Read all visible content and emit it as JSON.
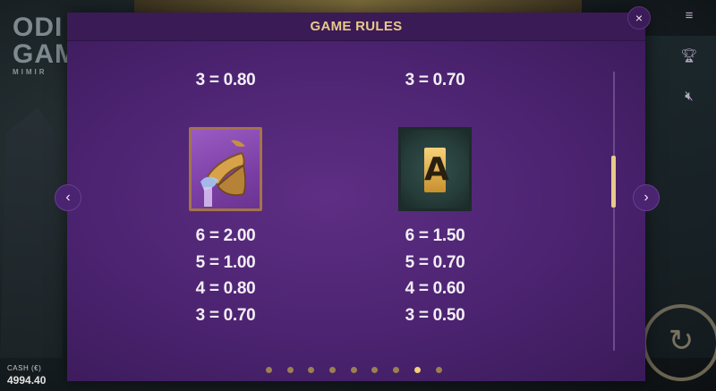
{
  "background": {
    "logo_line1": "ODI",
    "logo_line2": "GAM",
    "logo_sub": "MIMIR",
    "cash_label": "CASH (€)",
    "cash_value": "4994.40"
  },
  "dialog": {
    "title": "GAME RULES",
    "close_icon": "×",
    "prev_icon": "‹",
    "next_icon": "›"
  },
  "columns": [
    {
      "top_payout": "3 = 0.80",
      "symbol": "horn-icon",
      "payouts": [
        "6 = 2.00",
        "5 = 1.00",
        "4 = 0.80",
        "3 = 0.70"
      ]
    },
    {
      "top_payout": "3 = 0.70",
      "symbol": "rune-a-icon",
      "symbol_letter": "A",
      "payouts": [
        "6 = 1.50",
        "5 = 0.70",
        "4 = 0.60",
        "3 = 0.50"
      ]
    }
  ],
  "pagination": {
    "total": 9,
    "active_index": 7
  },
  "colors": {
    "accent_gold": "#e8c98a",
    "dialog_purple": "#4b2370",
    "dot_inactive": "#9a8052",
    "dot_active": "#f2cf79"
  }
}
